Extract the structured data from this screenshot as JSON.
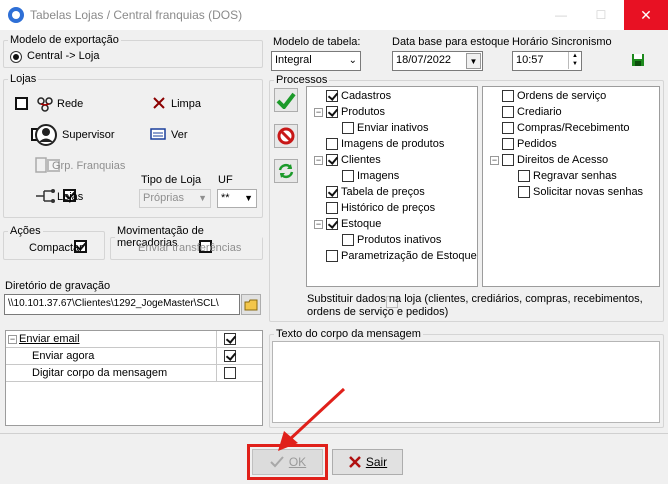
{
  "window": {
    "title": "Tabelas Lojas / Central franquias (DOS)",
    "min_glyph": "—",
    "max_glyph": "☐",
    "close_glyph": "✕"
  },
  "export_model": {
    "legend": "Modelo de exportação",
    "option": "Central -> Loja"
  },
  "stores": {
    "legend": "Lojas",
    "rede": "Rede",
    "limpa": "Limpa",
    "supervisor": "Supervisor",
    "ver": "Ver",
    "franquias": "Grp. Franquias",
    "lojas": "Lojas",
    "tipo_label": "Tipo de Loja",
    "tipo_value": "Próprias",
    "uf_label": "UF",
    "uf_value": "**"
  },
  "actions": {
    "legend": "Ações",
    "compactar": "Compactar"
  },
  "movement": {
    "legend": "Movimentação de mercadorias",
    "enviar": "Enviar transferências"
  },
  "directory": {
    "label": "Diretório de gravação",
    "value": "\\\\10.101.37.67\\Clientes\\1292_JogeMaster\\SCL\\"
  },
  "table_model": {
    "label": "Modelo de tabela:",
    "value": "Integral"
  },
  "base_date": {
    "label": "Data base para estoque",
    "value": "18/07/2022"
  },
  "sync_time": {
    "label": "Horário Sincronismo",
    "value": "10:57"
  },
  "processes": {
    "legend": "Processos",
    "left_tree": [
      {
        "label": "Cadastros",
        "checked": true,
        "level": 0,
        "expander": ""
      },
      {
        "label": "Produtos",
        "checked": true,
        "level": 0,
        "expander": "−"
      },
      {
        "label": "Enviar inativos",
        "checked": false,
        "level": 1,
        "expander": ""
      },
      {
        "label": "Imagens de produtos",
        "checked": false,
        "level": 0,
        "expander": ""
      },
      {
        "label": "Clientes",
        "checked": true,
        "level": 0,
        "expander": "−"
      },
      {
        "label": "Imagens",
        "checked": false,
        "level": 1,
        "expander": ""
      },
      {
        "label": "Tabela de preços",
        "checked": true,
        "level": 0,
        "expander": ""
      },
      {
        "label": "Histórico de preços",
        "checked": false,
        "level": 0,
        "expander": ""
      },
      {
        "label": "Estoque",
        "checked": true,
        "level": 0,
        "expander": "−"
      },
      {
        "label": "Produtos inativos",
        "checked": false,
        "level": 1,
        "expander": ""
      },
      {
        "label": "Parametrização de Estoque",
        "checked": false,
        "level": 0,
        "expander": ""
      }
    ],
    "right_tree": [
      {
        "label": "Ordens de serviço",
        "checked": false,
        "level": 0,
        "expander": ""
      },
      {
        "label": "Crediario",
        "checked": false,
        "level": 0,
        "expander": ""
      },
      {
        "label": "Compras/Recebimento",
        "checked": false,
        "level": 0,
        "expander": ""
      },
      {
        "label": "Pedidos",
        "checked": false,
        "level": 0,
        "expander": ""
      },
      {
        "label": "Direitos de Acesso",
        "checked": false,
        "level": 0,
        "expander": "−"
      },
      {
        "label": "Regravar senhas",
        "checked": false,
        "level": 1,
        "expander": ""
      },
      {
        "label": "Solicitar novas senhas",
        "checked": false,
        "level": 1,
        "expander": ""
      }
    ],
    "substitute_line1": "Substituir dados na loja (clientes, crediários, compras, recebimentos,",
    "substitute_line2": "ordens de serviço e pedidos)"
  },
  "email_grid": {
    "rows": [
      {
        "label": "Enviar email",
        "checked": true,
        "level": 0,
        "expander": "−"
      },
      {
        "label": "Enviar agora",
        "checked": true,
        "level": 1,
        "expander": ""
      },
      {
        "label": "Digitar corpo da mensagem",
        "checked": false,
        "level": 1,
        "expander": ""
      }
    ]
  },
  "message_body": {
    "legend": "Texto do corpo da mensagem"
  },
  "footer": {
    "ok": "OK",
    "exit": "Sair"
  },
  "colors": {
    "highlight": "#e0201a",
    "close": "#e81123"
  }
}
